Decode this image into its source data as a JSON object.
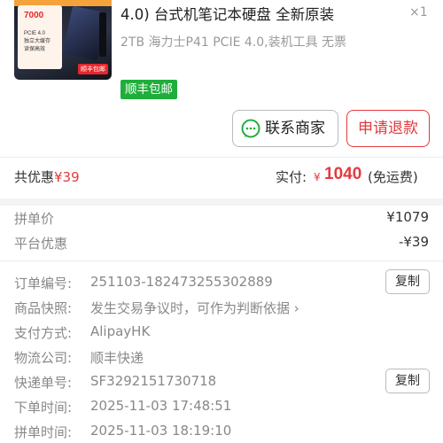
{
  "product": {
    "title": "4.0) 台式机笔记本硬盘 全新原装",
    "quantity": "×1",
    "spec": "2TB 海力士P41 PCIE 4.0,装机工具 无票",
    "shipping_badge": "顺丰包邮",
    "thumb_speed": "7000",
    "thumb_lines": [
      "PCIE 4.0",
      "独立大缓存",
      "读保高效"
    ],
    "thumb_tag": "顺丰包邮"
  },
  "actions": {
    "contact_seller": "联系商家",
    "request_refund": "申请退款"
  },
  "summary": {
    "discount_label": "共优惠",
    "discount_value": "¥39",
    "paid_label": "实付:",
    "paid_currency": "¥",
    "paid_amount": "1040",
    "paid_note": "(免运费)"
  },
  "price_rows": [
    {
      "label": "拼单价",
      "value": "¥1079"
    },
    {
      "label": "平台优惠",
      "value": "-¥39"
    }
  ],
  "order_info": {
    "order_no_label": "订单编号:",
    "order_no": "251103-182473255302889",
    "snapshot_label": "商品快照:",
    "snapshot_value": "发生交易争议时，可作为判断依据",
    "snapshot_chevron": "›",
    "payment_label": "支付方式:",
    "payment_value": "AlipayHK",
    "logistics_label": "物流公司:",
    "logistics_value": "顺丰快递",
    "tracking_label": "快递单号:",
    "tracking_value": "SF3292151730718",
    "order_time_label": "下单时间:",
    "order_time_value": "2025-11-03 17:48:51",
    "group_time_label": "拼单时间:",
    "group_time_value": "2025-11-03 18:19:10",
    "copy_label": "复制"
  },
  "colors": {
    "accent_red": "#e4393c",
    "badge_green": "#1fae3b"
  },
  "icons": {
    "contact": "chat-bubble-icon",
    "snapshot": "chevron-right-icon"
  }
}
